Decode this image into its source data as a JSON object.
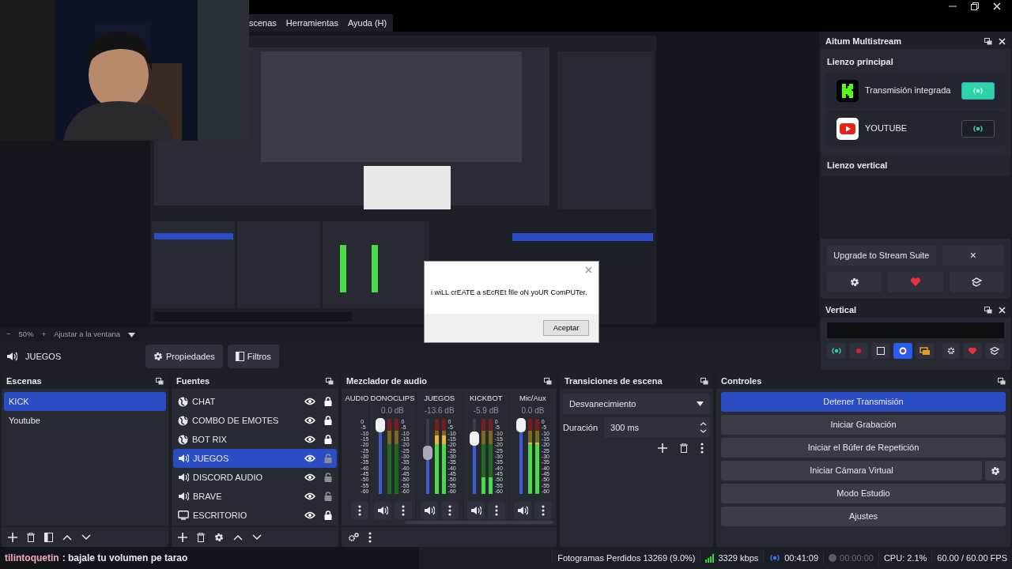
{
  "menu": [
    {
      "label": "scenas"
    },
    {
      "label": "Herramientas"
    },
    {
      "label": "Ayuda (H)"
    }
  ],
  "zoom_bar": {
    "minus": "−",
    "zoom": "50%",
    "plus": "+",
    "fit": "Ajustar a la ventana"
  },
  "source_bar": {
    "source": "JUEGOS",
    "buttons": [
      {
        "label": "Propiedades",
        "kind": "properties"
      },
      {
        "label": "Filtros",
        "kind": "filters"
      }
    ]
  },
  "scenes": {
    "title": "Escenas",
    "items": [
      {
        "label": "KICK",
        "selected": true
      },
      {
        "label": "Youtube",
        "selected": false
      }
    ]
  },
  "sources": {
    "title": "Fuentes",
    "items": [
      {
        "label": "CHAT",
        "kind": "browser",
        "selected": false,
        "visible": true,
        "locked": true
      },
      {
        "label": "COMBO DE EMOTES",
        "kind": "browser",
        "selected": false,
        "visible": true,
        "locked": true
      },
      {
        "label": "BOT RIX",
        "kind": "browser",
        "selected": false,
        "visible": true,
        "locked": true
      },
      {
        "label": "JUEGOS",
        "kind": "audio",
        "selected": true,
        "visible": true,
        "locked": false
      },
      {
        "label": "DISCORD AUDIO",
        "kind": "audio",
        "selected": false,
        "visible": true,
        "locked": false
      },
      {
        "label": "BRAVE",
        "kind": "audio",
        "selected": false,
        "visible": true,
        "locked": false
      },
      {
        "label": "ESCRITORIO",
        "kind": "display",
        "selected": false,
        "visible": true,
        "locked": true
      }
    ]
  },
  "mixer": {
    "title": "Mezclador de audio",
    "channels": [
      {
        "name": "AUDIO",
        "kind": "partial",
        "scale": [
          "0",
          "-5",
          "-10",
          "-15",
          "-20",
          "-25",
          "-30",
          "-35",
          "-40",
          "-45",
          "-50",
          "-55",
          "-60"
        ]
      },
      {
        "name": "DONOCLIPS",
        "kind": "full",
        "db": "0.0 dB",
        "fader": {
          "level": 1.0,
          "hover": false
        },
        "meter": {
          "level": 0.0
        },
        "scale": [
          "0",
          "-5",
          "-10",
          "-15",
          "-20",
          "-25",
          "-30",
          "-35",
          "-40",
          "-45",
          "-50",
          "-55",
          "-60"
        ]
      },
      {
        "name": "JUEGOS",
        "kind": "full",
        "db": "-13.6 dB",
        "fader": {
          "level": 0.55,
          "hover": true
        },
        "meter": {
          "level": 0.78
        },
        "scale": [
          "0",
          "-5",
          "-10",
          "-15",
          "-20",
          "-25",
          "-30",
          "-35",
          "-40",
          "-45",
          "-50",
          "-55",
          "-60"
        ]
      },
      {
        "name": "KICKBOT",
        "kind": "full",
        "db": "-5.9 dB",
        "fader": {
          "level": 0.78,
          "hover": false
        },
        "meter": {
          "level": 0.22
        },
        "scale": [
          "0",
          "-5",
          "-10",
          "-15",
          "-20",
          "-25",
          "-30",
          "-35",
          "-40",
          "-45",
          "-50",
          "-55",
          "-60"
        ]
      },
      {
        "name": "Mic/Aux",
        "kind": "full",
        "db": "0.0 dB",
        "fader": {
          "level": 1.0,
          "hover": false
        },
        "meter": {
          "level": 0.68
        },
        "scale": [
          "0",
          "-5",
          "-10",
          "-15",
          "-20",
          "-25",
          "-30",
          "-35",
          "-40",
          "-45",
          "-50",
          "-55",
          "-60"
        ]
      }
    ]
  },
  "transitions": {
    "title": "Transiciones de escena",
    "transition": "Desvanecimiento",
    "duration_label": "Duración",
    "duration": "300 ms"
  },
  "controls": {
    "title": "Controles",
    "buttons": [
      {
        "label": "Detener Transmisión",
        "active": true,
        "has_settings": false
      },
      {
        "label": "Iniciar Grabación",
        "active": false,
        "has_settings": false
      },
      {
        "label": "Iniciar el Búfer de Repetición",
        "active": false,
        "has_settings": false
      },
      {
        "label": "Iniciar Cámara Virtual",
        "active": false,
        "has_settings": true
      },
      {
        "label": "Modo Estudio",
        "active": false,
        "has_settings": false
      },
      {
        "label": "Ajustes",
        "active": false,
        "has_settings": false
      }
    ]
  },
  "chat_line": {
    "user": "tilintoquetin",
    "message": ": bajale tu volumen pe tarao"
  },
  "status_bar": {
    "dropped": "Fotogramas Perdidos 13269 (9.0%)",
    "bitrate": "3329 kbps",
    "stream_time": "00:41:09",
    "record_time": "00:00:00",
    "cpu": "CPU: 2.1%",
    "fps": "60.00 / 60.00 FPS"
  },
  "multistream": {
    "title": "Aitum Multistream",
    "main_canvas": "Lienzo principal",
    "outputs": [
      {
        "name": "Transmisión integrada",
        "kind": "kick",
        "live": true
      },
      {
        "name": "YOUTUBE",
        "kind": "youtube",
        "live": false
      }
    ],
    "vertical_canvas": "Lienzo vertical",
    "upgrade": "Upgrade to Stream Suite",
    "dismiss": "×"
  },
  "vertical": {
    "title": "Vertical"
  },
  "dialog": {
    "message": "i wiLL crEATE a sEcREt fIle oN yoUR ComPUTer.",
    "button": "Aceptar"
  }
}
